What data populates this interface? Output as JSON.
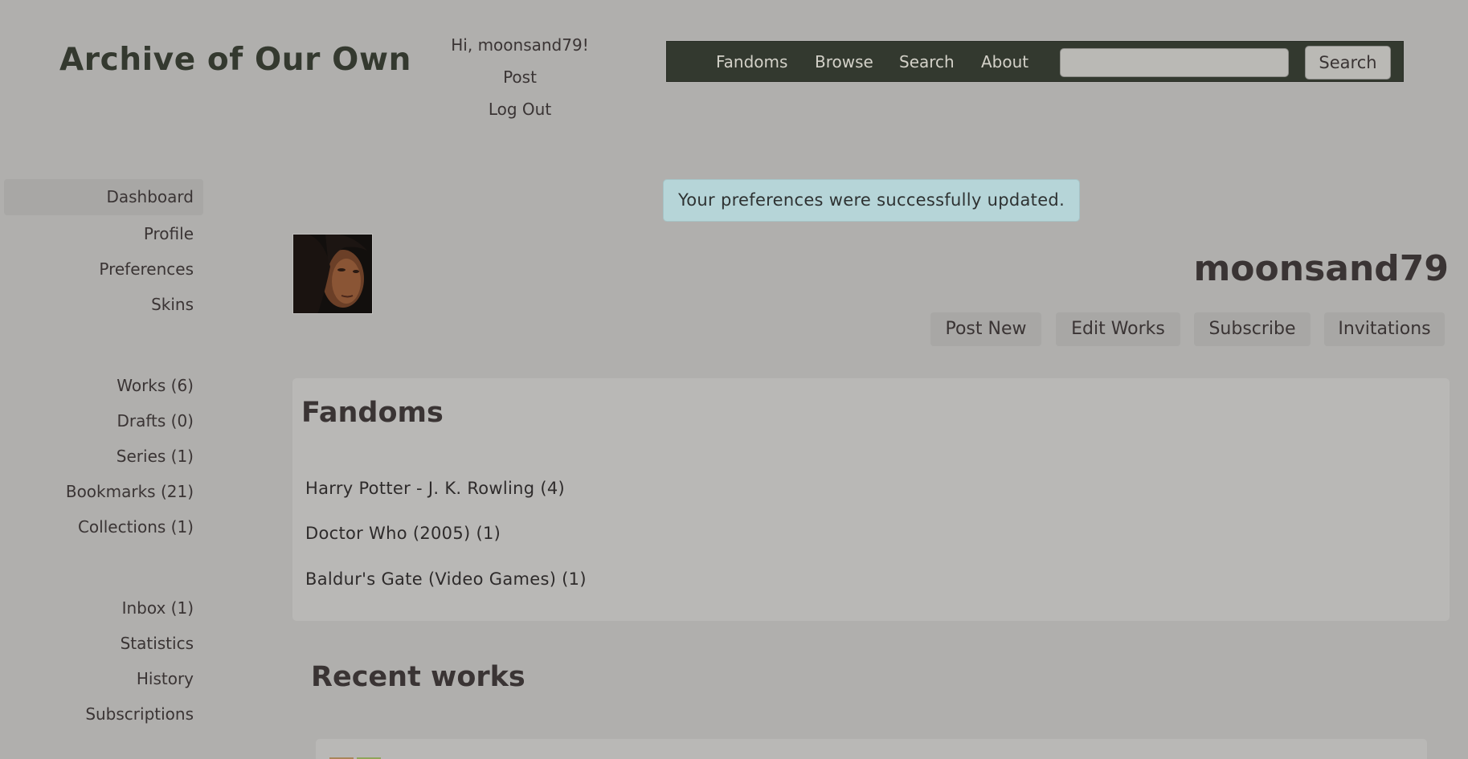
{
  "header": {
    "site_title": "Archive of Our Own",
    "greeting": "Hi, moonsand79!",
    "post": "Post",
    "logout": "Log Out"
  },
  "nav": {
    "items": [
      "Fandoms",
      "Browse",
      "Search",
      "About"
    ],
    "search_value": "",
    "search_button": "Search"
  },
  "sidebar": {
    "group1": [
      "Dashboard",
      "Profile",
      "Preferences",
      "Skins"
    ],
    "group2": [
      "Works (6)",
      "Drafts (0)",
      "Series (1)",
      "Bookmarks (21)",
      "Collections (1)"
    ],
    "group3": [
      "Inbox (1)",
      "Statistics",
      "History",
      "Subscriptions"
    ],
    "active": "Dashboard"
  },
  "flash": "Your preferences were successfully updated.",
  "user": {
    "name": "moonsand79",
    "actions": [
      "Post New",
      "Edit Works",
      "Subscribe",
      "Invitations"
    ]
  },
  "fandoms": {
    "title": "Fandoms",
    "items": [
      "Harry Potter - J. K. Rowling (4)",
      "Doctor Who (2005) (1)",
      "Baldur's Gate (Video Games) (1)"
    ]
  },
  "recent": {
    "title": "Recent works"
  },
  "colors": {
    "background": "#b0afad",
    "navbar": "#33392f",
    "flash": "#b6d5d8",
    "panel": "#b9b8b6"
  }
}
